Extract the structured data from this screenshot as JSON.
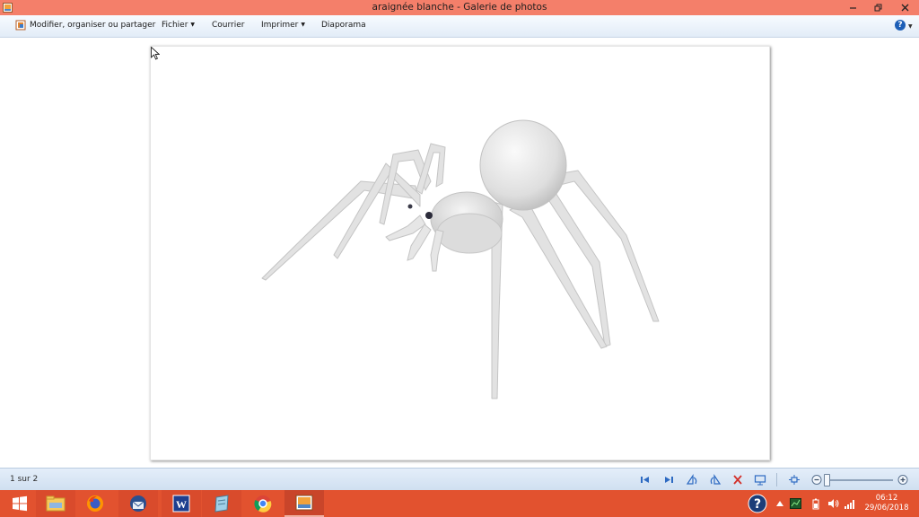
{
  "window": {
    "title": "araignée blanche - Galerie de photos",
    "controls": [
      "minimize",
      "restore",
      "close"
    ]
  },
  "toolbar": {
    "items": [
      {
        "label": "Modifier, organiser ou partager",
        "icon": "edit-icon"
      },
      {
        "label": "Fichier",
        "has_menu": true
      },
      {
        "label": "Courrier",
        "has_menu": false
      },
      {
        "label": "Imprimer",
        "has_menu": true
      },
      {
        "label": "Diaporama",
        "has_menu": false
      }
    ],
    "help_label": "?"
  },
  "photo": {
    "subject": "white 3D spider",
    "background": "#ffffff"
  },
  "statusbar": {
    "page_counter": "1 sur 2",
    "controls": [
      "first-icon",
      "next-icon",
      "rotate-left-icon",
      "rotate-right-icon",
      "delete-icon",
      "slideshow-icon",
      "fit-icon",
      "zoom-out-icon",
      "zoom-in-icon"
    ],
    "zoom_level": 0
  },
  "taskbar": {
    "apps": [
      "start",
      "file-explorer",
      "firefox",
      "thunderbird",
      "word",
      "notepad",
      "chrome",
      "photo-gallery"
    ],
    "active_app": "photo-gallery",
    "clock": {
      "time": "06:12",
      "date": "29/06/2018"
    }
  },
  "colors": {
    "titlebar": "#f47f6a",
    "taskbar": "#e2522f",
    "toolbar": "#e8f0fa"
  }
}
